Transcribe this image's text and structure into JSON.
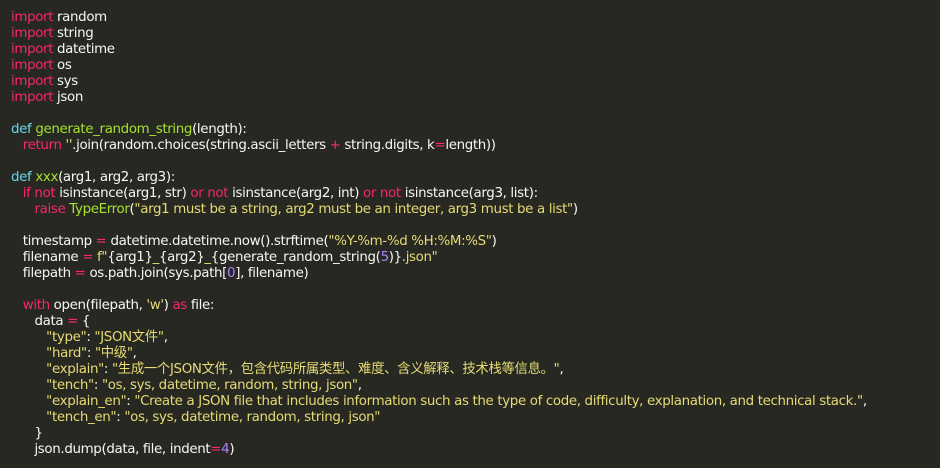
{
  "colors": {
    "background": "#272822",
    "keyword": "#f92672",
    "definition": "#66d9ef",
    "function": "#a6e22e",
    "string": "#e6db74",
    "number": "#ae81ff",
    "text": "#f8f8f2"
  },
  "code_lines": [
    [
      [
        "kw",
        "import"
      ],
      [
        "plain",
        " random"
      ]
    ],
    [
      [
        "kw",
        "import"
      ],
      [
        "plain",
        " string"
      ]
    ],
    [
      [
        "kw",
        "import"
      ],
      [
        "plain",
        " datetime"
      ]
    ],
    [
      [
        "kw",
        "import"
      ],
      [
        "plain",
        " os"
      ]
    ],
    [
      [
        "kw",
        "import"
      ],
      [
        "plain",
        " sys"
      ]
    ],
    [
      [
        "kw",
        "import"
      ],
      [
        "plain",
        " json"
      ]
    ],
    [],
    [
      [
        "def",
        "def"
      ],
      [
        "plain",
        " "
      ],
      [
        "fn",
        "generate_random_string"
      ],
      [
        "plain",
        "(length):"
      ]
    ],
    [
      [
        "plain",
        "   "
      ],
      [
        "kw",
        "return"
      ],
      [
        "plain",
        " "
      ],
      [
        "str",
        "''"
      ],
      [
        "plain",
        ".join(random.choices(string.ascii_letters "
      ],
      [
        "op",
        "+"
      ],
      [
        "plain",
        " string.digits, k"
      ],
      [
        "op",
        "="
      ],
      [
        "plain",
        "length))"
      ]
    ],
    [],
    [
      [
        "def",
        "def"
      ],
      [
        "plain",
        " "
      ],
      [
        "fn",
        "xxx"
      ],
      [
        "plain",
        "(arg1, arg2, arg3):"
      ]
    ],
    [
      [
        "plain",
        "   "
      ],
      [
        "kw",
        "if"
      ],
      [
        "plain",
        " "
      ],
      [
        "kw",
        "not"
      ],
      [
        "plain",
        " isinstance(arg1, str) "
      ],
      [
        "kw",
        "or"
      ],
      [
        "plain",
        " "
      ],
      [
        "kw",
        "not"
      ],
      [
        "plain",
        " isinstance(arg2, int) "
      ],
      [
        "kw",
        "or"
      ],
      [
        "plain",
        " "
      ],
      [
        "kw",
        "not"
      ],
      [
        "plain",
        " isinstance(arg3, list):"
      ]
    ],
    [
      [
        "plain",
        "      "
      ],
      [
        "kw",
        "raise"
      ],
      [
        "plain",
        " "
      ],
      [
        "fn",
        "TypeError"
      ],
      [
        "plain",
        "("
      ],
      [
        "str",
        "\"arg1 must be a string, arg2 must be an integer, arg3 must be a list\""
      ],
      [
        "plain",
        ")"
      ]
    ],
    [],
    [
      [
        "plain",
        "   timestamp "
      ],
      [
        "op",
        "="
      ],
      [
        "plain",
        " datetime.datetime.now().strftime("
      ],
      [
        "str",
        "\"%Y-%m-%d %H:%M:%S\""
      ],
      [
        "plain",
        ")"
      ]
    ],
    [
      [
        "plain",
        "   filename "
      ],
      [
        "op",
        "="
      ],
      [
        "plain",
        " "
      ],
      [
        "str",
        "f\""
      ],
      [
        "plain",
        "{arg1}"
      ],
      [
        "str",
        "_"
      ],
      [
        "plain",
        "{arg2}"
      ],
      [
        "str",
        "_"
      ],
      [
        "plain",
        "{generate_random_string("
      ],
      [
        "num",
        "5"
      ],
      [
        "plain",
        ")}"
      ],
      [
        "str",
        ".json\""
      ]
    ],
    [
      [
        "plain",
        "   filepath "
      ],
      [
        "op",
        "="
      ],
      [
        "plain",
        " os.path.join(sys.path["
      ],
      [
        "num",
        "0"
      ],
      [
        "plain",
        "], filename)"
      ]
    ],
    [],
    [
      [
        "plain",
        "   "
      ],
      [
        "kw",
        "with"
      ],
      [
        "plain",
        " open(filepath, "
      ],
      [
        "str",
        "'w'"
      ],
      [
        "plain",
        ") "
      ],
      [
        "kw",
        "as"
      ],
      [
        "plain",
        " file:"
      ]
    ],
    [
      [
        "plain",
        "      data "
      ],
      [
        "op",
        "="
      ],
      [
        "plain",
        " {"
      ]
    ],
    [
      [
        "plain",
        "         "
      ],
      [
        "str",
        "\"type\""
      ],
      [
        "plain",
        ": "
      ],
      [
        "str",
        "\"JSON文件\""
      ],
      [
        "plain",
        ","
      ]
    ],
    [
      [
        "plain",
        "         "
      ],
      [
        "str",
        "\"hard\""
      ],
      [
        "plain",
        ": "
      ],
      [
        "str",
        "\"中级\""
      ],
      [
        "plain",
        ","
      ]
    ],
    [
      [
        "plain",
        "         "
      ],
      [
        "str",
        "\"explain\""
      ],
      [
        "plain",
        ": "
      ],
      [
        "str",
        "\"生成一个JSON文件，包含代码所属类型、难度、含义解释、技术栈等信息。\""
      ],
      [
        "plain",
        ","
      ]
    ],
    [
      [
        "plain",
        "         "
      ],
      [
        "str",
        "\"tench\""
      ],
      [
        "plain",
        ": "
      ],
      [
        "str",
        "\"os, sys, datetime, random, string, json\""
      ],
      [
        "plain",
        ","
      ]
    ],
    [
      [
        "plain",
        "         "
      ],
      [
        "str",
        "\"explain_en\""
      ],
      [
        "plain",
        ": "
      ],
      [
        "str",
        "\"Create a JSON file that includes information such as the type of code, difficulty, explanation, and technical stack.\""
      ],
      [
        "plain",
        ","
      ]
    ],
    [
      [
        "plain",
        "         "
      ],
      [
        "str",
        "\"tench_en\""
      ],
      [
        "plain",
        ": "
      ],
      [
        "str",
        "\"os, sys, datetime, random, string, json\""
      ]
    ],
    [
      [
        "plain",
        "      }"
      ]
    ],
    [
      [
        "plain",
        "      json.dump(data, file, indent"
      ],
      [
        "op",
        "="
      ],
      [
        "num",
        "4"
      ],
      [
        "plain",
        ")"
      ]
    ]
  ]
}
